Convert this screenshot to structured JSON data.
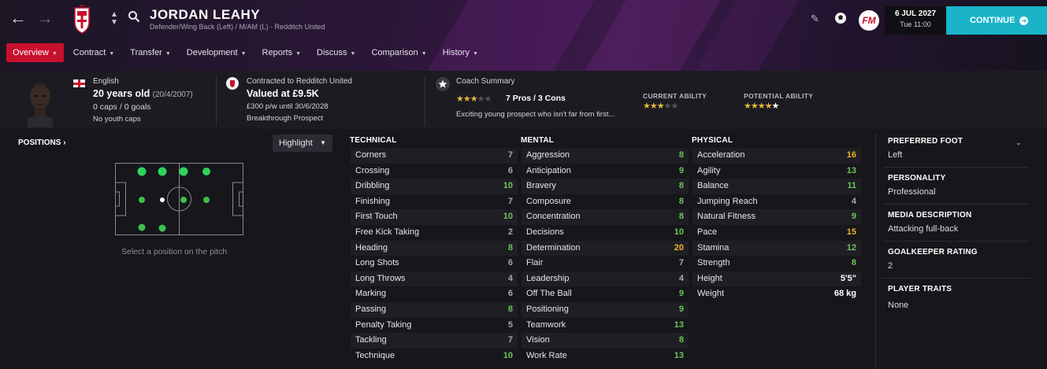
{
  "header": {
    "player_name": "JORDAN LEAHY",
    "player_subtitle": "Defender/Wing Back (Left) / M/AM (L) - Redditch United",
    "date": "6 JUL 2027",
    "time": "Tue 11:00",
    "continue_label": "CONTINUE",
    "fm_logo": "FM",
    "icons": [
      "back-arrow-icon",
      "forward-arrow-icon",
      "club-crest-icon",
      "up-down-icon",
      "search-icon",
      "pencil-icon",
      "football-icon",
      "fm-logo-icon"
    ]
  },
  "tabs": [
    {
      "label": "Overview",
      "active": true
    },
    {
      "label": "Contract"
    },
    {
      "label": "Transfer"
    },
    {
      "label": "Development"
    },
    {
      "label": "Reports"
    },
    {
      "label": "Discuss"
    },
    {
      "label": "Comparison"
    },
    {
      "label": "History"
    }
  ],
  "info": {
    "nationality": "English",
    "age": "20 years old",
    "dob": "(20/4/2007)",
    "caps": "0 caps / 0 goals",
    "youth_caps": "No youth caps",
    "contract_club": "Contracted to Redditch United",
    "value": "Valued at £9.5K",
    "wage": "£300 p/w until 30/6/2028",
    "status": "Breakthrough Prospect",
    "coach_title": "Coach Summary",
    "pros_cons": "7 Pros / 3 Cons",
    "coach_text": "Exciting young prospect who isn't far from first...",
    "coach_stars": 3,
    "current_ability_label": "CURRENT ABILITY",
    "current_ability_stars": 3,
    "potential_ability_label": "POTENTIAL ABILITY",
    "potential_ability_stars": 4.5
  },
  "positions": {
    "label": "POSITIONS",
    "highlight_label": "Highlight",
    "caption": "Select a position on the pitch"
  },
  "technical": {
    "title": "TECHNICAL",
    "rows": [
      {
        "name": "Corners",
        "value": "7"
      },
      {
        "name": "Crossing",
        "value": "6"
      },
      {
        "name": "Dribbling",
        "value": "10"
      },
      {
        "name": "Finishing",
        "value": "7"
      },
      {
        "name": "First Touch",
        "value": "10"
      },
      {
        "name": "Free Kick Taking",
        "value": "2"
      },
      {
        "name": "Heading",
        "value": "8"
      },
      {
        "name": "Long Shots",
        "value": "6"
      },
      {
        "name": "Long Throws",
        "value": "4"
      },
      {
        "name": "Marking",
        "value": "6"
      },
      {
        "name": "Passing",
        "value": "8"
      },
      {
        "name": "Penalty Taking",
        "value": "5"
      },
      {
        "name": "Tackling",
        "value": "7"
      },
      {
        "name": "Technique",
        "value": "10"
      }
    ]
  },
  "mental": {
    "title": "MENTAL",
    "rows": [
      {
        "name": "Aggression",
        "value": "8"
      },
      {
        "name": "Anticipation",
        "value": "9"
      },
      {
        "name": "Bravery",
        "value": "8"
      },
      {
        "name": "Composure",
        "value": "8"
      },
      {
        "name": "Concentration",
        "value": "8"
      },
      {
        "name": "Decisions",
        "value": "10"
      },
      {
        "name": "Determination",
        "value": "20"
      },
      {
        "name": "Flair",
        "value": "7"
      },
      {
        "name": "Leadership",
        "value": "4"
      },
      {
        "name": "Off The Ball",
        "value": "9"
      },
      {
        "name": "Positioning",
        "value": "9"
      },
      {
        "name": "Teamwork",
        "value": "13"
      },
      {
        "name": "Vision",
        "value": "8"
      },
      {
        "name": "Work Rate",
        "value": "13"
      }
    ]
  },
  "physical": {
    "title": "PHYSICAL",
    "rows": [
      {
        "name": "Acceleration",
        "value": "16"
      },
      {
        "name": "Agility",
        "value": "13"
      },
      {
        "name": "Balance",
        "value": "11"
      },
      {
        "name": "Jumping Reach",
        "value": "4"
      },
      {
        "name": "Natural Fitness",
        "value": "9"
      },
      {
        "name": "Pace",
        "value": "15"
      },
      {
        "name": "Stamina",
        "value": "12"
      },
      {
        "name": "Strength",
        "value": "8"
      },
      {
        "name": "Height",
        "value": "5'5\""
      },
      {
        "name": "Weight",
        "value": "68 kg"
      }
    ]
  },
  "side": {
    "preferred_foot_label": "PREFERRED FOOT",
    "preferred_foot": "Left",
    "personality_label": "PERSONALITY",
    "personality": "Professional",
    "media_label": "MEDIA DESCRIPTION",
    "media": "Attacking full-back",
    "gk_label": "GOALKEEPER RATING",
    "gk": "2",
    "traits_label": "PLAYER TRAITS",
    "traits": "None"
  },
  "colors": {
    "accent_red": "#c8102e",
    "continue_teal": "#1ab3c8",
    "attr_green": "#6cc55a",
    "attr_yellow": "#e9b32b",
    "attr_grey": "#a9a7b1",
    "star_gold": "#e5b83b"
  }
}
